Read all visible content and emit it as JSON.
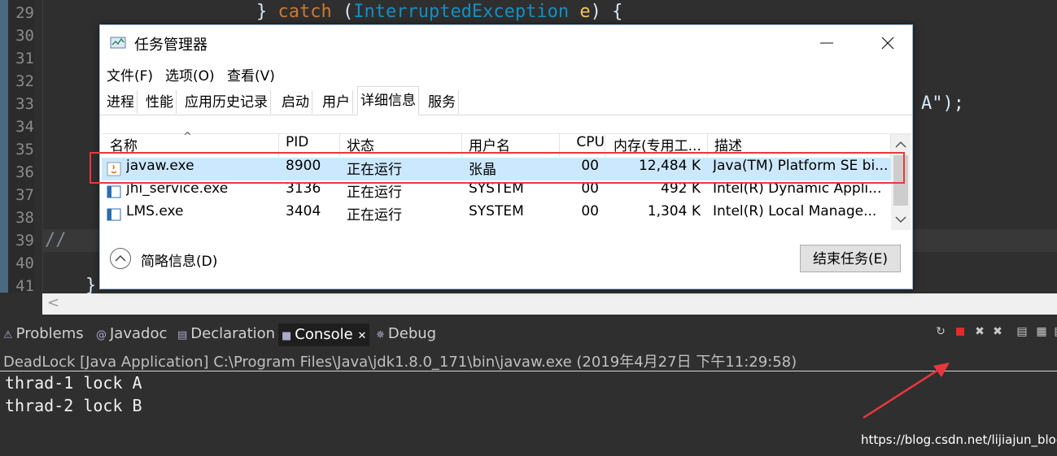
{
  "editor": {
    "line_numbers": [
      "29",
      "30",
      "31",
      "32",
      "33",
      "34",
      "35",
      "36",
      "37",
      "38",
      "39",
      "40",
      "41"
    ],
    "line29": {
      "brace": "} ",
      "kw": "catch",
      "open": " (",
      "type": "InterruptedException",
      "space": " ",
      "var": "e",
      "close": ") {"
    },
    "line33_tail": "A\");",
    "line39": "//",
    "line41": "}"
  },
  "task_manager": {
    "title": "任务管理器",
    "menu": [
      "文件(F)",
      "选项(O)",
      "查看(V)"
    ],
    "tabs": [
      "进程",
      "性能",
      "应用历史记录",
      "启动",
      "用户",
      "详细信息",
      "服务"
    ],
    "active_tab": "详细信息",
    "columns": [
      "名称",
      "PID",
      "状态",
      "用户名",
      "CPU",
      "内存(专用工...",
      "描述"
    ],
    "rows": [
      {
        "name": "javaw.exe",
        "pid": "8900",
        "status": "正在运行",
        "user": "张晶",
        "cpu": "00",
        "mem": "12,484 K",
        "desc": "Java(TM) Platform SE bi..."
      },
      {
        "name": "jhi_service.exe",
        "pid": "3136",
        "status": "正在运行",
        "user": "SYSTEM",
        "cpu": "00",
        "mem": "492 K",
        "desc": "Intel(R) Dynamic Appli..."
      },
      {
        "name": "LMS.exe",
        "pid": "3404",
        "status": "正在运行",
        "user": "SYSTEM",
        "cpu": "00",
        "mem": "1,304 K",
        "desc": "Intel(R) Local Manage..."
      }
    ],
    "footer": {
      "collapse_label": "简略信息(D)",
      "end_task_label": "结束任务(E)"
    },
    "window_buttons": {
      "minimize": "—",
      "maximize": "☐",
      "close": "✕"
    }
  },
  "panel": {
    "tabs": [
      "Problems",
      "Javadoc",
      "Declaration",
      "Console",
      "Debug"
    ],
    "active_tab": "Console",
    "console_tab_close": "✕",
    "console_header": "DeadLock [Java Application] C:\\Program Files\\Java\\jdk1.8.0_171\\bin\\javaw.exe (2019年4月27日 下午11:29:58)",
    "output": [
      "thrad-1 lock A",
      "thrad-2 lock B"
    ]
  },
  "annotation": {
    "highlight_color": "#e8383d"
  },
  "watermark": "https://blog.csdn.net/lijiajun_blog"
}
